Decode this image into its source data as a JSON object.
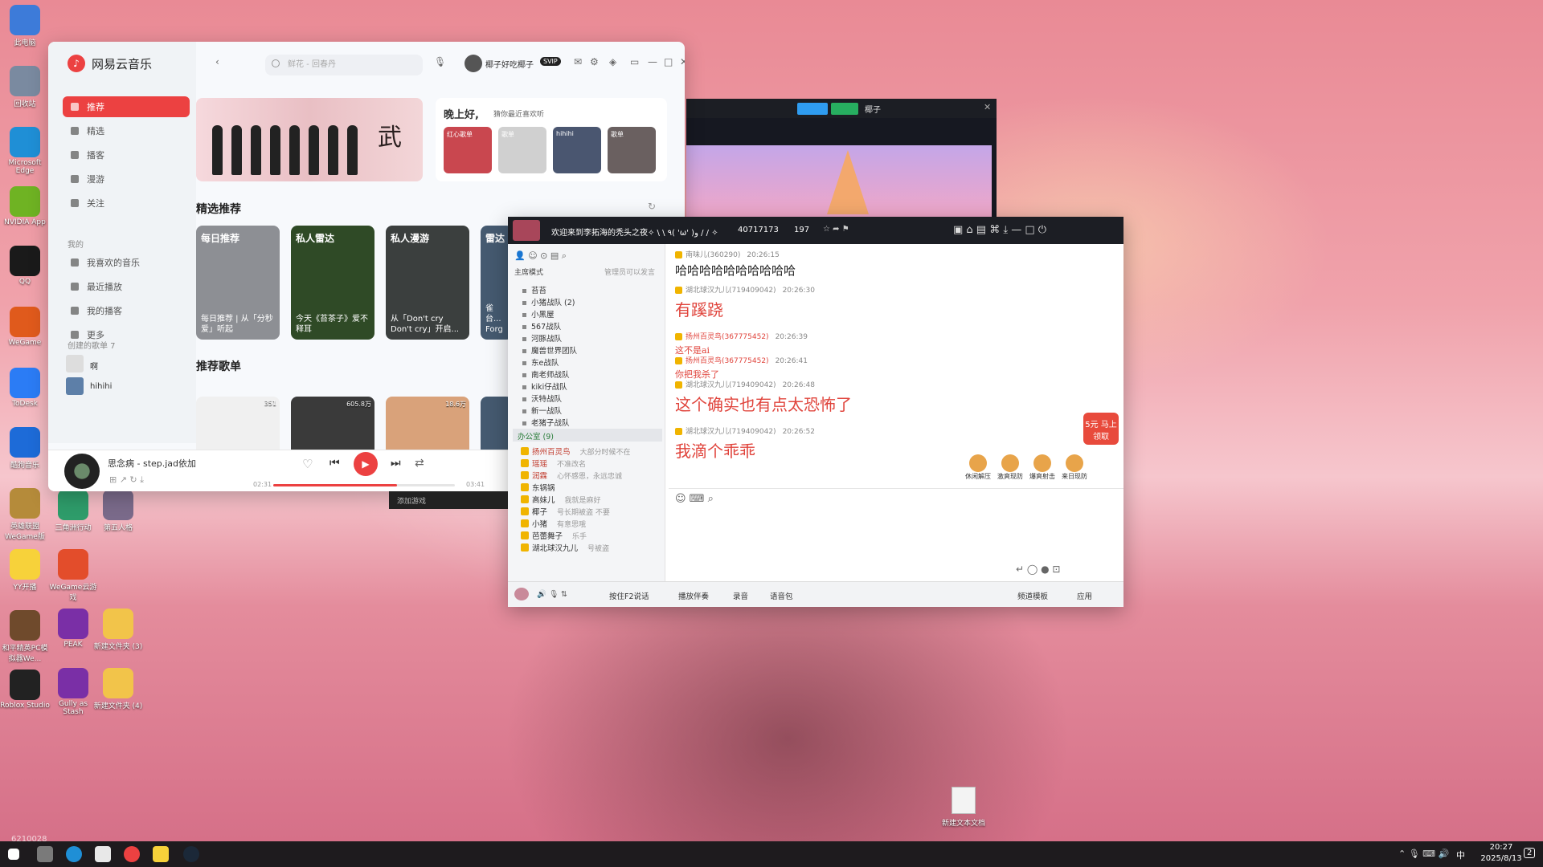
{
  "desktop": {
    "icons": [
      {
        "label": "此电脑",
        "color": "#3d7bd9"
      },
      {
        "label": "回收站",
        "color": "#7a8aa0"
      },
      {
        "label": "Microsoft Edge",
        "color": "#1f8fd6"
      },
      {
        "label": "NVIDIA App",
        "color": "#6fb323"
      },
      {
        "label": "QQ",
        "color": "#1a1a1a"
      },
      {
        "label": "WeGame",
        "color": "#e05a1c"
      },
      {
        "label": "ToDesk",
        "color": "#2b7cf5"
      },
      {
        "label": "酷狗音乐",
        "color": "#1d6bd8"
      },
      {
        "label": "英雄联盟 WeGame版",
        "color": "#b58b3a"
      },
      {
        "label": "YY开播",
        "color": "#f7d23a"
      },
      {
        "label": "和平精英PC模拟器We...",
        "color": "#6f4a2c"
      },
      {
        "label": "Roblox Studio",
        "color": "#222222"
      }
    ],
    "icons2": [
      {
        "label": "三角洲行动",
        "color": "#2e9c6a"
      },
      {
        "label": "第五人格",
        "color": "#7a6a8a"
      },
      {
        "label": "WeGame云游戏",
        "color": "#e34d2b"
      },
      {
        "label": "PEAK",
        "color": "#7a2fa6"
      },
      {
        "label": "新建文件夹 (3)",
        "color": "#f2c44a"
      },
      {
        "label": "Gully as Stash",
        "color": "#7a2fa6"
      },
      {
        "label": "新建文件夹 (4)",
        "color": "#f2c44a"
      }
    ],
    "file_icon": "新建文本文档"
  },
  "music": {
    "app_name": "网易云音乐",
    "search_placeholder": "鲜花 - 回春丹",
    "username": "椰子好吃椰子",
    "vip": "SVIP",
    "nav": [
      {
        "label": "推荐"
      },
      {
        "label": "精选"
      },
      {
        "label": "播客"
      },
      {
        "label": "漫游"
      },
      {
        "label": "关注"
      }
    ],
    "my_label": "我的",
    "my_items": [
      {
        "label": "我喜欢的音乐"
      },
      {
        "label": "最近播放"
      },
      {
        "label": "我的播客"
      },
      {
        "label": "更多"
      }
    ],
    "created_label": "创建的歌单 7",
    "playlists": [
      {
        "label": "啊"
      },
      {
        "label": "hihihi"
      }
    ],
    "greeting": "晚上好,",
    "greeting_sub": "猜你最近喜欢听",
    "mini_cards": [
      {
        "label": "红心歌单"
      },
      {
        "label": "歌单"
      },
      {
        "label": "hihihi"
      },
      {
        "label": "歌单"
      }
    ],
    "featured_title": "精选推荐",
    "rec_cards": [
      {
        "title": "每日推荐",
        "desc": "每日推荐 | 从「分秒爱」听起",
        "color": "#8d8f94"
      },
      {
        "title": "私人雷达",
        "desc": "今天《苔茶子》爱不释耳",
        "color": "#2f4a26"
      },
      {
        "title": "私人漫游",
        "desc": "从「Don't cry Don't cry」开启...",
        "color": "#3b3f3e"
      },
      {
        "title": "雷达",
        "desc": "雀台... Forg",
        "color": "#455a70"
      }
    ],
    "playlist_title": "推荐歌单",
    "pl_counts": [
      "351",
      "605.8万",
      "18.6万"
    ],
    "now_playing": "思念病 - step.jad依加",
    "time_current": "02:31",
    "time_total": "03:41",
    "progress": 0.68
  },
  "voice": {
    "channel_title": "欢迎来到李拓海的秃头之夜✧ \\ \\ ٩( 'ω' )و / / ✧",
    "channel_id": "40717173",
    "online_count": "197",
    "mode": "主席模式",
    "admin_note": "管理员可以发言",
    "groups": [
      "苔苔",
      "小猪战队 (2)",
      "小黑屋",
      "567战队",
      "河豚战队",
      "魔兽世界团队",
      "东e战队",
      "南老师战队",
      "kiki仔战队",
      "沃特战队",
      "新一战队",
      "老猪子战队"
    ],
    "office": "办公室 (9)",
    "members": [
      {
        "name": "扬州百灵鸟",
        "note": "大部分时候不在",
        "color": "#c0392b"
      },
      {
        "name": "瑶瑶",
        "note": "不准改名",
        "color": "#c0392b"
      },
      {
        "name": "润霖",
        "note": "心怀感恩，永远忠诚",
        "color": "#c0392b"
      },
      {
        "name": "东锅锅",
        "note": "",
        "color": "#333333"
      },
      {
        "name": "高妹儿",
        "note": "我就是麻好",
        "color": "#333333"
      },
      {
        "name": "椰子",
        "note": "号长期被盗 不要",
        "color": "#333333"
      },
      {
        "name": "小猪",
        "note": "有意思哦",
        "color": "#333333"
      },
      {
        "name": "芭蕾舞子",
        "note": "乐手",
        "color": "#333333"
      },
      {
        "name": "湖北球汉九儿",
        "note": "号被盗",
        "color": "#333333"
      }
    ],
    "messages": [
      {
        "user": "南味儿(360290)",
        "time": "20:26:15",
        "text": "哈哈哈哈哈哈哈哈哈哈",
        "color": "#222222",
        "size": 15
      },
      {
        "user": "湖北球汉九儿(719409042)",
        "time": "20:26:30",
        "text": "有蹊跷",
        "color": "#e0443c",
        "size": 20
      },
      {
        "user": "扬州百灵鸟(367775452)",
        "time": "20:26:39",
        "text": "这不是ai",
        "color": "#e0443c",
        "size": 11
      },
      {
        "user": "扬州百灵鸟(367775452)",
        "time": "20:26:41",
        "text": "你把我杀了",
        "color": "#e0443c",
        "size": 11
      },
      {
        "user": "湖北球汉九儿(719409042)",
        "time": "20:26:48",
        "text": "这个确实也有点太恐怖了",
        "color": "#e0443c",
        "size": 20
      },
      {
        "user": "湖北球汉九儿(719409042)",
        "time": "20:26:52",
        "text": "我滴个乖乖",
        "color": "#e0443c",
        "size": 20
      }
    ],
    "promo": "5元 马上领取",
    "gifts": [
      "休闲解压",
      "激爽现防",
      "爆爽射击",
      "来日现防"
    ],
    "bottom": [
      "按住F2说话",
      "播放伴奏",
      "录音",
      "语音包",
      "频道模板",
      "应用"
    ],
    "extra": "添加游戏"
  },
  "video_window": {
    "user": "椰子"
  },
  "taskbar": {
    "time": "20:27",
    "date": "2025/8/13",
    "ime": "中",
    "notif": "2"
  },
  "watermark": "6210028"
}
